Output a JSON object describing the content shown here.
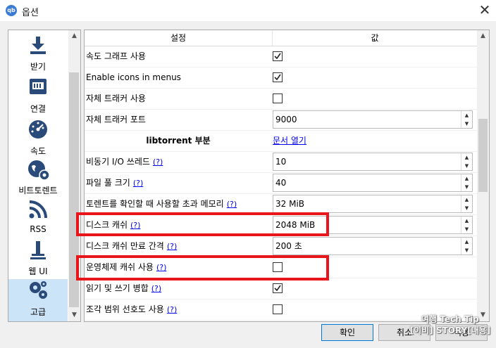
{
  "window": {
    "app_icon_text": "qb",
    "title": "옵션",
    "close_glyph": "✕"
  },
  "sidebar": {
    "items": [
      {
        "label": "받기",
        "icon": "download-icon"
      },
      {
        "label": "연결",
        "icon": "network-icon"
      },
      {
        "label": "속도",
        "icon": "speedometer-icon"
      },
      {
        "label": "비트토렌트",
        "icon": "globe-gear-icon"
      },
      {
        "label": "RSS",
        "icon": "rss-icon"
      },
      {
        "label": "웹 UI",
        "icon": "webui-icon"
      },
      {
        "label": "고급",
        "icon": "gears-icon",
        "selected": true
      }
    ]
  },
  "table": {
    "headers": {
      "setting": "설정",
      "value": "값"
    },
    "rows": [
      {
        "label": "속도 그래프 사용",
        "type": "checkbox",
        "checked": true
      },
      {
        "label": "Enable icons in menus",
        "type": "checkbox",
        "checked": true
      },
      {
        "label": "자체 트래커 사용",
        "type": "checkbox",
        "checked": false
      },
      {
        "label": "자체 트래커 포트",
        "type": "spin",
        "value": "9000"
      },
      {
        "label": "libtorrent 부분",
        "type": "link",
        "value": "문서 열기",
        "section": true
      },
      {
        "label": "비동기 I/O 쓰레드",
        "help": "(?)",
        "type": "spin",
        "value": "10"
      },
      {
        "label": "파일 풀 크기",
        "help": "(?)",
        "type": "spin",
        "value": "40"
      },
      {
        "label": "토렌트를 확인할 때 사용할 초과 메모리",
        "help": "(?)",
        "type": "spin",
        "value": "32 MiB"
      },
      {
        "label": "디스크 캐쉬",
        "help": "(?)",
        "type": "spin",
        "value": "2048 MiB"
      },
      {
        "label": "디스크 캐쉬 만료 간격",
        "help": "(?)",
        "type": "spin",
        "value": "200 초"
      },
      {
        "label": "운영체제 캐쉬 사용",
        "help": "(?)",
        "type": "checkbox",
        "checked": false
      },
      {
        "label": "읽기 및 쓰기 병합",
        "help": "(?)",
        "type": "checkbox",
        "checked": true
      },
      {
        "label": "조각 범위 선호도 사용",
        "help": "(?)",
        "type": "checkbox",
        "checked": false
      }
    ]
  },
  "buttons": {
    "ok": "확인",
    "cancel": "취소",
    "apply": "적용"
  },
  "watermark": {
    "line1": "여행 Tech Tip",
    "line2": "[이비] STORY[내용]"
  },
  "colors": {
    "highlight": "#e8151b",
    "link": "#0000ee",
    "selected": "#cce4f7"
  }
}
